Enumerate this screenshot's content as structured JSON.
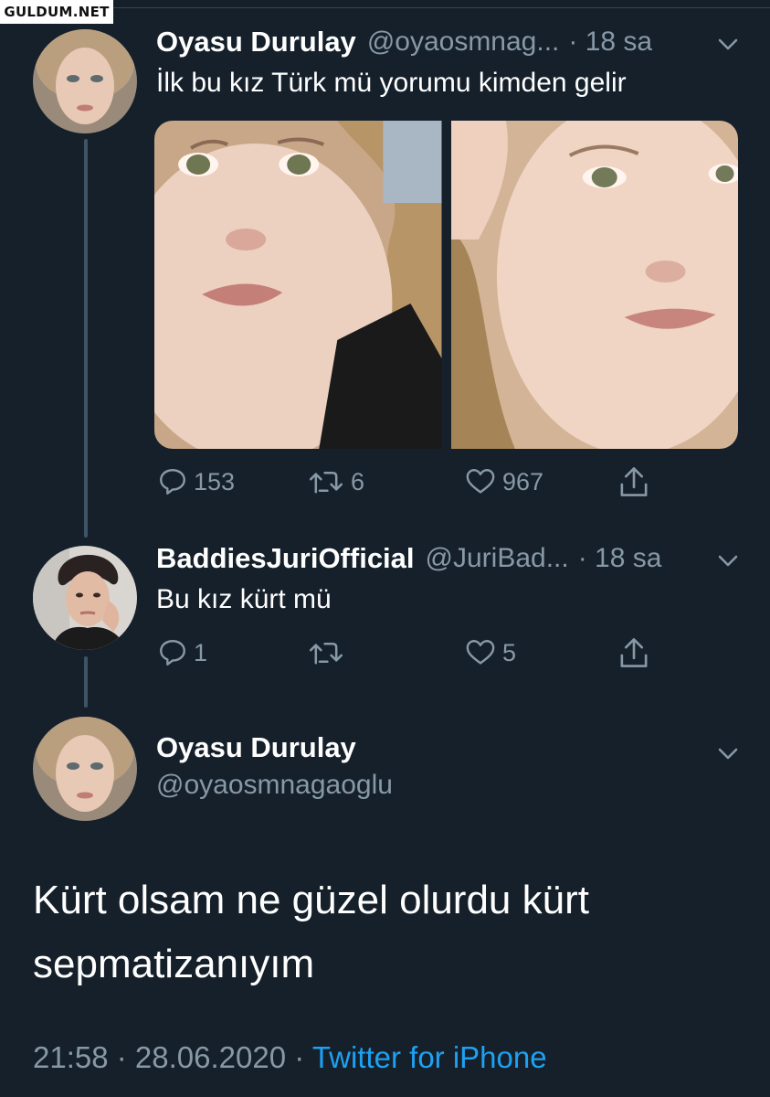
{
  "watermark": "GULDUM.NET",
  "tweets": [
    {
      "name": "Oyasu Durulay",
      "handle": "@oyaosmnag...",
      "time": "· 18 sa",
      "text": "İlk bu kız Türk mü yorumu kimden gelir",
      "avatar_icon": "avatar-girl",
      "actions": {
        "reply_count": "153",
        "retweet_count": "6",
        "like_count": "967"
      }
    },
    {
      "name": "BaddiesJuriOfficial",
      "handle": "@JuriBad...",
      "time": "· 18 sa",
      "text": "Bu kız kürt mü",
      "avatar_icon": "avatar-boy",
      "actions": {
        "reply_count": "1",
        "retweet_count": "",
        "like_count": "5"
      }
    }
  ],
  "main_tweet": {
    "name": "Oyasu Durulay",
    "handle": "@oyaosmnagaoglu",
    "text": "Kürt olsam ne güzel olurdu kürt sepmatizanıyım",
    "time": "21:58 · 28.06.2020 · ",
    "source": "Twitter for iPhone"
  },
  "colors": {
    "background": "#15202b",
    "secondary_text": "#8899a6",
    "link": "#1da1f2",
    "thread_line": "#3d5466"
  },
  "icons": [
    "reply-icon",
    "retweet-icon",
    "like-icon",
    "share-icon",
    "chevron-down-icon"
  ]
}
